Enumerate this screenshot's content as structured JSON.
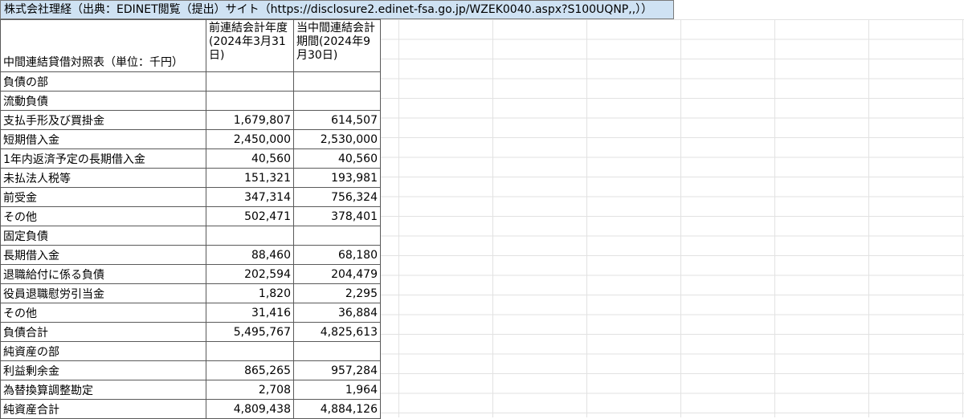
{
  "title": "株式会社理経（出典：EDINET閲覧（提出）サイト（https://disclosure2.edinet-fsa.go.jp/WZEK0040.aspx?S100UQNP,,））",
  "header": {
    "label": "中間連結貸借対照表（単位：千円）",
    "col_prev": "前連結会計年度(2024年3月31日)",
    "col_curr": "当中間連結会計期間(2024年9月30日)"
  },
  "rows": [
    {
      "label": "負債の部",
      "prev": "",
      "curr": ""
    },
    {
      "label": "流動負債",
      "prev": "",
      "curr": ""
    },
    {
      "label": "支払手形及び買掛金",
      "prev": "1,679,807",
      "curr": "614,507"
    },
    {
      "label": "短期借入金",
      "prev": "2,450,000",
      "curr": "2,530,000"
    },
    {
      "label": "1年内返済予定の長期借入金",
      "prev": "40,560",
      "curr": "40,560"
    },
    {
      "label": "未払法人税等",
      "prev": "151,321",
      "curr": "193,981"
    },
    {
      "label": "前受金",
      "prev": "347,314",
      "curr": "756,324"
    },
    {
      "label": "その他",
      "prev": "502,471",
      "curr": "378,401"
    },
    {
      "label": "固定負債",
      "prev": "",
      "curr": ""
    },
    {
      "label": "長期借入金",
      "prev": "88,460",
      "curr": "68,180"
    },
    {
      "label": "退職給付に係る負債",
      "prev": "202,594",
      "curr": "204,479"
    },
    {
      "label": "役員退職慰労引当金",
      "prev": "1,820",
      "curr": "2,295"
    },
    {
      "label": "その他",
      "prev": "31,416",
      "curr": "36,884"
    },
    {
      "label": "負債合計",
      "prev": "5,495,767",
      "curr": "4,825,613"
    },
    {
      "label": "純資産の部",
      "prev": "",
      "curr": ""
    },
    {
      "label": "利益剰余金",
      "prev": "865,265",
      "curr": "957,284"
    },
    {
      "label": "為替換算調整勘定",
      "prev": "2,708",
      "curr": "1,964"
    },
    {
      "label": "純資産合計",
      "prev": "4,809,438",
      "curr": "4,884,126"
    }
  ],
  "colors": {
    "title_bg": "#cfe2f3",
    "border": "#5a5a5a",
    "gridline": "#e2e2e2"
  }
}
